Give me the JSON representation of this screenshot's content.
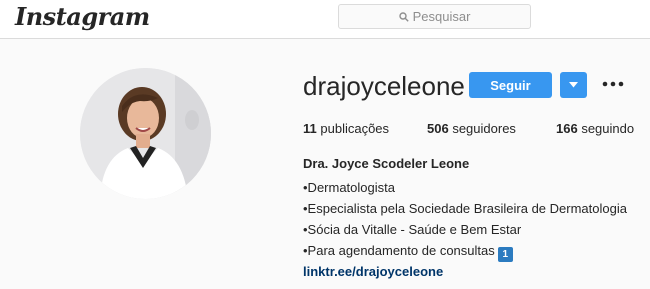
{
  "header": {
    "logo_text": "Instagram",
    "search_placeholder": "Pesquisar",
    "search_icon": "search-icon"
  },
  "profile": {
    "username": "drajoyceleone",
    "follow_label": "Seguir",
    "dropdown_icon": "chevron-down-icon",
    "more_icon": "more-options-icon",
    "avatar_icon": "profile-photo",
    "stats": {
      "posts_count": "11",
      "posts_label": "publicações",
      "followers_count": "506",
      "followers_label": "seguidores",
      "following_count": "166",
      "following_label": "seguindo"
    },
    "full_name": "Dra. Joyce Scodeler Leone",
    "bio_lines": [
      "•Dermatologista",
      "•Especialista pela Sociedade Brasileira de Dermatologia",
      "•Sócia da Vitalle - Saúde e Bem Estar",
      "•Para agendamento de consultas"
    ],
    "badge_text": "1",
    "website": "linktr.ee/drajoyceleone"
  },
  "colors": {
    "accent": "#3897f0",
    "link": "#003569",
    "background": "#fafafa"
  }
}
